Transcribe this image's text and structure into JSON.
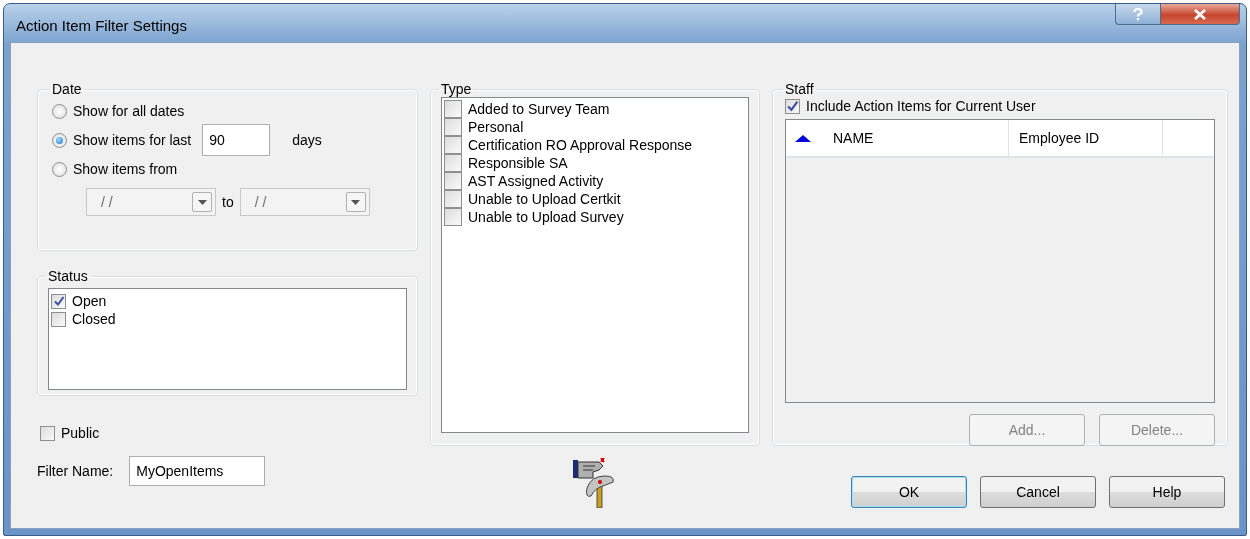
{
  "window": {
    "title": "Action Item Filter Settings"
  },
  "date": {
    "label": "Date",
    "options": [
      {
        "kind": "plain",
        "label": "Show for all dates",
        "selected": false
      },
      {
        "kind": "days",
        "label": "Show items for last",
        "selected": true,
        "value": "90",
        "suffix": "days"
      },
      {
        "kind": "range",
        "label": "Show items from",
        "selected": false,
        "from": "/ /",
        "connector": "to",
        "to": "/ /",
        "disabled": true
      }
    ]
  },
  "status": {
    "label": "Status",
    "items": [
      {
        "label": "Open",
        "checked": true
      },
      {
        "label": "Closed",
        "checked": false
      }
    ]
  },
  "public": {
    "label": "Public",
    "checked": false
  },
  "filter_name": {
    "label": "Filter Name:",
    "value": "MyOpenItems"
  },
  "type": {
    "label": "Type",
    "items": [
      {
        "label": "Added to Survey Team",
        "checked": false
      },
      {
        "label": "Personal",
        "checked": false
      },
      {
        "label": "Certification RO Approval Response",
        "checked": false
      },
      {
        "label": "Responsible SA",
        "checked": false
      },
      {
        "label": "AST Assigned Activity",
        "checked": false
      },
      {
        "label": "Unable to Upload Certkit",
        "checked": false
      },
      {
        "label": "Unable to Upload Survey",
        "checked": false
      }
    ]
  },
  "staff": {
    "label": "Staff",
    "include": {
      "label": "Include Action Items for Current User",
      "checked": true
    },
    "columns": [
      {
        "label": "NAME",
        "sorted": true
      },
      {
        "label": "Employee ID",
        "sorted": false
      }
    ],
    "buttons": [
      {
        "label": "Add...",
        "disabled": true
      },
      {
        "label": "Delete...",
        "disabled": true
      }
    ]
  },
  "buttons": [
    {
      "label": "OK",
      "default": true
    },
    {
      "label": "Cancel",
      "default": false
    },
    {
      "label": "Help",
      "default": false
    }
  ]
}
